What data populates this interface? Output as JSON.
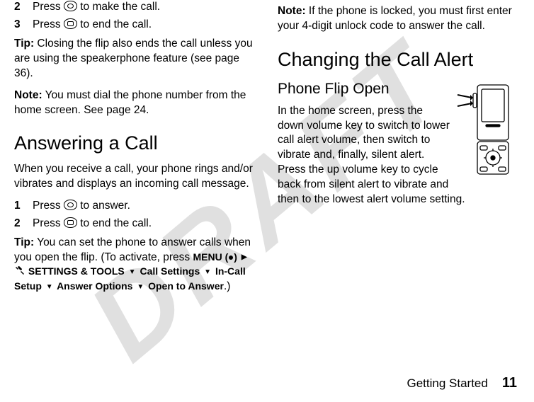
{
  "watermark": "DRAFT",
  "left": {
    "step2_num": "2",
    "step2_pre": "Press ",
    "step2_post": " to make the call.",
    "step3_num": "3",
    "step3_pre": "Press ",
    "step3_post": " to end the call.",
    "tip1_label": "Tip:",
    "tip1_text": " Closing the flip also ends the call unless you are using the speakerphone feature (see page 36).",
    "note1_label": "Note:",
    "note1_text": " You must dial the phone number from the home screen. See page 24.",
    "answering_heading": "Answering a Call",
    "answering_intro": "When you receive a call, your phone rings and/or vibrates and displays an incoming call message.",
    "a_step1_num": "1",
    "a_step1_pre": "Press ",
    "a_step1_post": " to answer.",
    "a_step2_num": "2",
    "a_step2_pre": "Press ",
    "a_step2_post": " to end the call.",
    "tip2_label": "Tip:",
    "tip2_text_pre": " You can set the phone to answer calls when you open the flip. (To activate, press ",
    "menu_label": "MENU",
    "settings_tools": "SETTINGS & TOOLS",
    "call_settings": "Call Settings",
    "in_call_setup": "In-Call Setup",
    "answer_options": "Answer Options",
    "open_to_answer": "Open to Answer",
    "tip2_close": ".)"
  },
  "right": {
    "note_label": "Note:",
    "note_text": " If the phone is locked, you must first enter your 4-digit unlock code to answer the call.",
    "changing_heading": "Changing the Call Alert",
    "flip_open_heading": "Phone Flip Open",
    "flip_open_text": "In the home screen, press the down volume key to switch to lower call alert volume, then switch to vibrate and, finally, silent alert. Press the up volume key to cycle back from silent alert to vibrate and then to the lowest alert volume setting."
  },
  "footer": {
    "section": "Getting Started",
    "page": "11"
  }
}
